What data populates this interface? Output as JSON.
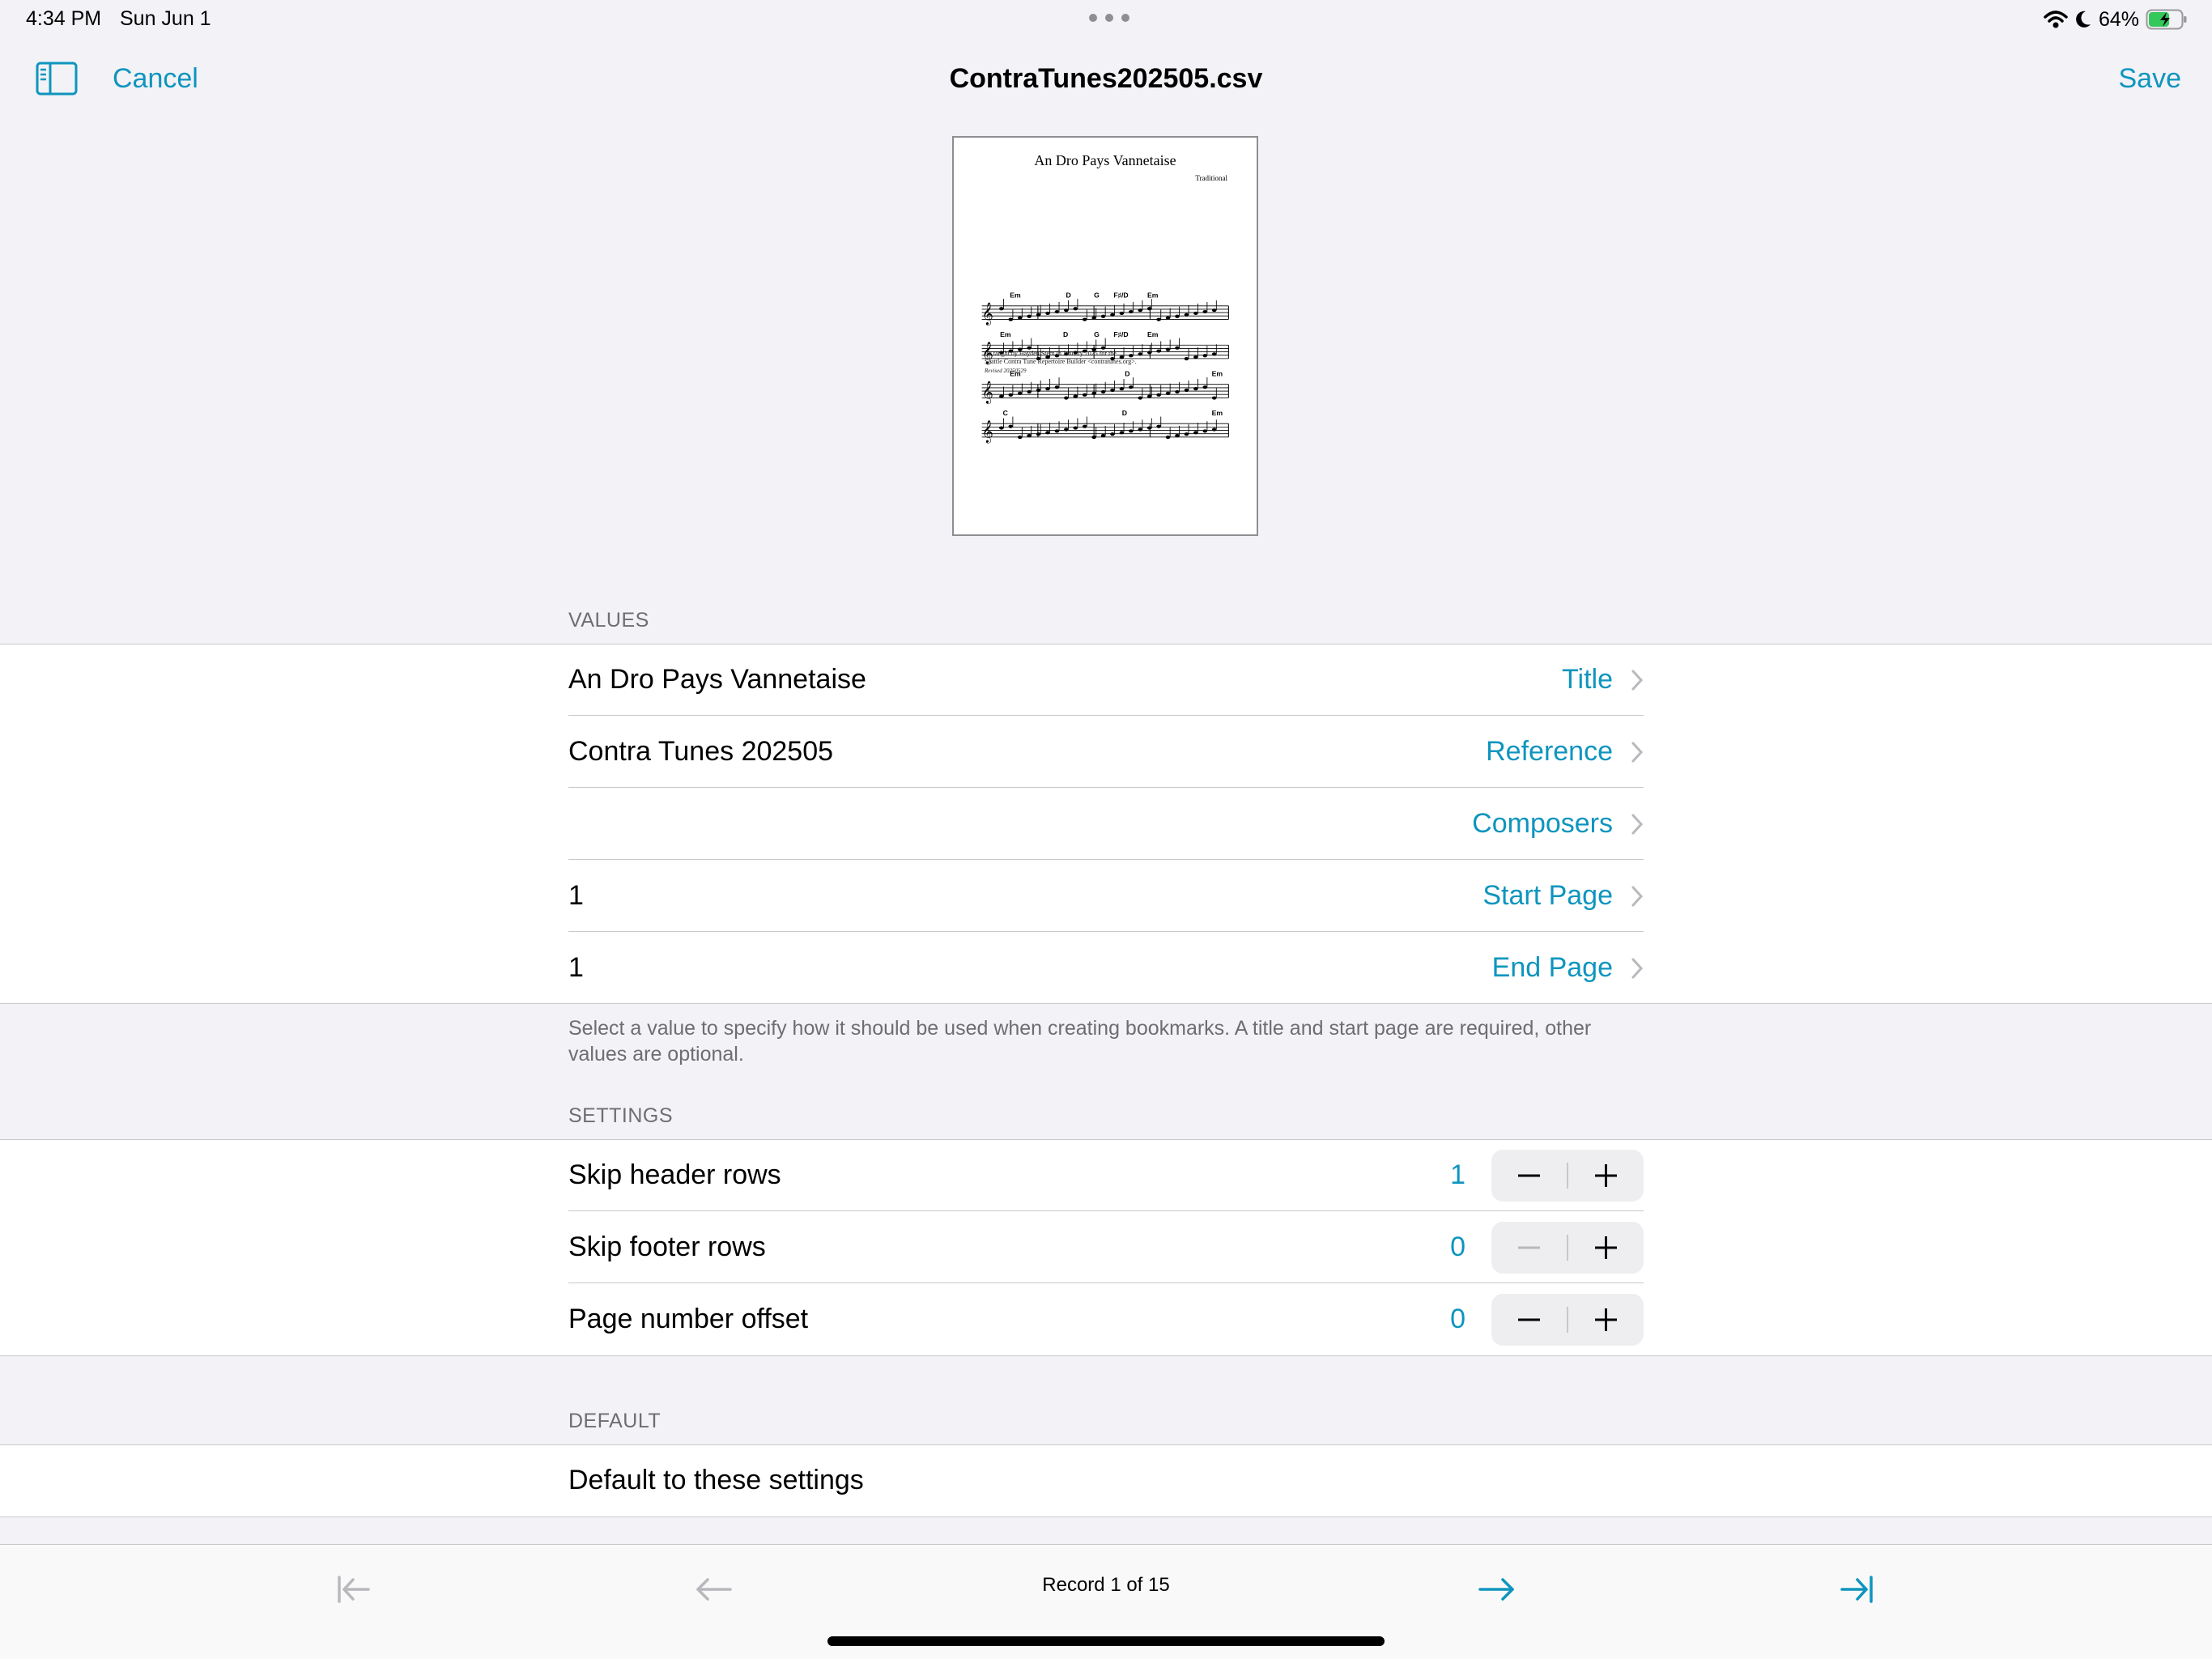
{
  "status_bar": {
    "time": "4:34 PM",
    "date": "Sun Jun 1",
    "battery_percent": "64%",
    "battery_level": 0.64
  },
  "nav": {
    "cancel_label": "Cancel",
    "title": "ContraTunes202505.csv",
    "save_label": "Save"
  },
  "preview": {
    "title": "An Dro Pays Vannetaise",
    "composer": "Traditional",
    "chords_row1": [
      "Em",
      "D",
      "G",
      "F♯/D",
      "Em"
    ],
    "chords_row2": [
      "Em",
      "D",
      "G",
      "F♯/D",
      "Em"
    ],
    "chords_row3": [
      "Em",
      "D",
      "Em"
    ],
    "chords_row4": [
      "C",
      "D",
      "Em"
    ],
    "caption_line1": "As taught by Hayden Stern in January 2025 for the",
    "caption_line2": "Seattle Contra Tune Repertoire Builder <contratunes.org>.",
    "caption_line3": "Revised 20250529"
  },
  "values": {
    "header": "VALUES",
    "rows": [
      {
        "value": "An Dro Pays Vannetaise",
        "field": "Title"
      },
      {
        "value": "Contra Tunes 202505",
        "field": "Reference"
      },
      {
        "value": "",
        "field": "Composers"
      },
      {
        "value": "1",
        "field": "Start Page"
      },
      {
        "value": "1",
        "field": "End Page"
      }
    ],
    "footnote": "Select a value to specify how it should be used when creating bookmarks. A title and start page are required, other values are optional."
  },
  "settings": {
    "header": "SETTINGS",
    "rows": [
      {
        "label": "Skip header rows",
        "value": "1"
      },
      {
        "label": "Skip footer rows",
        "value": "0"
      },
      {
        "label": "Page number offset",
        "value": "0"
      }
    ]
  },
  "default": {
    "header": "DEFAULT",
    "row_label": "Default to these settings"
  },
  "toolbar": {
    "record_label": "Record 1 of 15"
  },
  "colors": {
    "accent": "#0e95be",
    "disabled": "#b8b8bd",
    "background": "#f2f2f7"
  },
  "icons": [
    "sidebar-icon",
    "chevron-right-icon",
    "minus-icon",
    "plus-icon",
    "first-record-icon",
    "previous-record-icon",
    "next-record-icon",
    "last-record-icon",
    "wifi-icon",
    "moon-icon",
    "battery-icon",
    "multitask-dots-icon"
  ]
}
